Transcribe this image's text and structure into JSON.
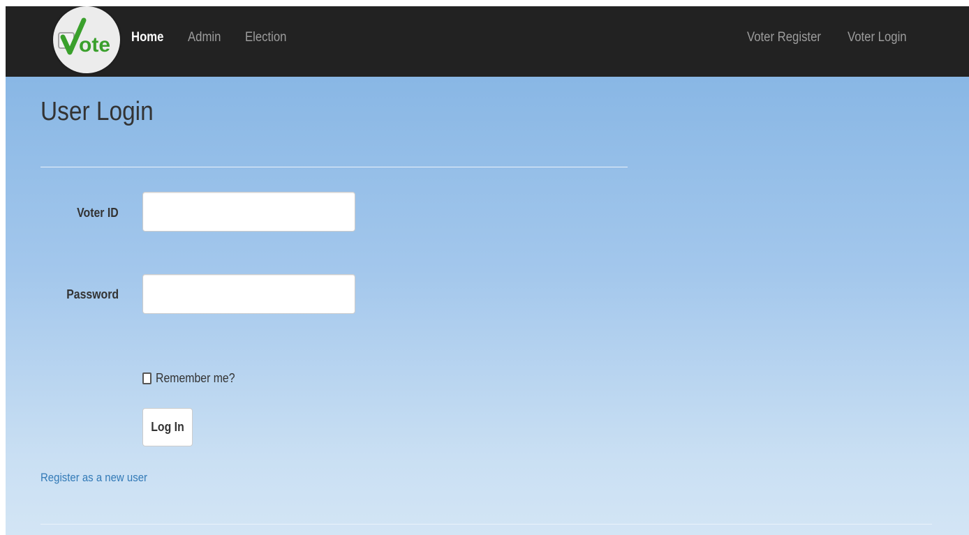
{
  "navbar": {
    "logo_text": "Vote",
    "left_links": [
      "Home",
      "Admin",
      "Election"
    ],
    "right_links": [
      "Voter Register",
      "Voter Login"
    ],
    "active_link": "Home"
  },
  "page": {
    "title": "User Login"
  },
  "form": {
    "voter_id_label": "Voter ID",
    "voter_id_value": "",
    "password_label": "Password",
    "password_value": "",
    "remember_label": "Remember me?",
    "remember_checked": false,
    "login_button": "Log In",
    "register_link": "Register as a new user"
  },
  "colors": {
    "navbar_bg": "#222222",
    "nav_text": "#9d9d9d",
    "nav_active": "#ffffff",
    "link": "#337ab7",
    "logo_green": "#3aa02c",
    "bg_top": "#7fb1e2",
    "bg_bottom": "#d3e5f5"
  }
}
